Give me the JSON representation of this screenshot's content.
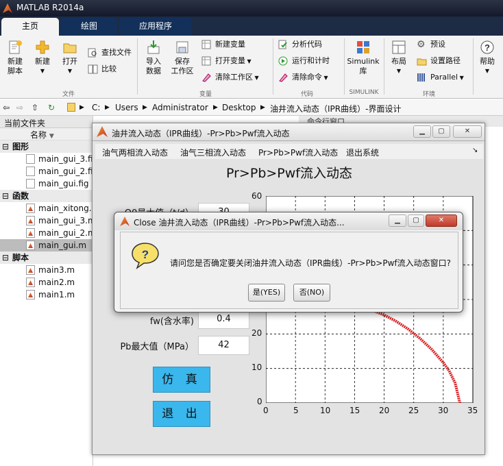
{
  "app_title": "MATLAB R2014a",
  "tabs": [
    "主页",
    "绘图",
    "应用程序"
  ],
  "ribbon": {
    "new_script": "新建\n脚本",
    "new": "新建",
    "open": "打开",
    "find_files": "查找文件",
    "compare": "比较",
    "import_data": "导入\n数据",
    "save_workspace": "保存\n工作区",
    "new_variable": "新建变量",
    "open_variable": "打开变量",
    "clear_workspace": "清除工作区",
    "analyze_code": "分析代码",
    "run_and_time": "运行和计时",
    "clear_commands": "清除命令",
    "simulink": "Simulink\n库",
    "layout": "布局",
    "preferences": "预设",
    "set_path": "设置路径",
    "parallel": "Parallel",
    "help": "帮助",
    "groups": {
      "file": "文件",
      "variable": "变量",
      "code": "代码",
      "simulink": "SIMULINK",
      "environment": "环境"
    }
  },
  "address": {
    "parts": [
      "C:",
      "Users",
      "Administrator",
      "Desktop",
      "油井流入动态（IPR曲线）-界面设计"
    ]
  },
  "current_folder": {
    "title": "当前文件夹",
    "name_column": "名称",
    "groups": [
      {
        "label": "图形",
        "files": [
          "main_gui_3.fig",
          "main_gui_2.fig",
          "main_gui.fig"
        ]
      },
      {
        "label": "函数",
        "files": [
          "main_xitong.m",
          "main_gui_3.m",
          "main_gui_2.m",
          "main_gui.m"
        ]
      },
      {
        "label": "脚本",
        "files": [
          "main3.m",
          "main2.m",
          "main1.m"
        ]
      }
    ]
  },
  "command_window_title": "命令行窗口",
  "gui": {
    "title": "油井流入动态（IPR曲线）-Pr>Pb>Pwf流入动态",
    "menu": [
      "油气两相流入动态",
      "油气三相流入动态",
      "Pr>Pb>Pwf流入动态",
      "退出系统"
    ],
    "plot_title": "Pr>Pb>Pwf流入动态",
    "fields": [
      {
        "label": "Q0最大值（t/d）",
        "value": "30"
      },
      {
        "label": "fw(含水率)",
        "value": "0.4"
      },
      {
        "label": "Pb最大值（MPa）",
        "value": "42"
      }
    ],
    "simulate_button": "仿 真",
    "exit_button": "退 出"
  },
  "chart_data": {
    "type": "line",
    "xlim": [
      0,
      35
    ],
    "ylim": [
      0,
      60
    ],
    "xticks": [
      0,
      5,
      10,
      15,
      20,
      25,
      30,
      35
    ],
    "yticks": [
      0,
      10,
      20,
      30,
      40,
      50,
      60
    ],
    "grid": true,
    "series": [
      {
        "color": "#d62020",
        "x": [
          17.8,
          20,
          22,
          24,
          26,
          28,
          30,
          31,
          32,
          32.8
        ],
        "y": [
          27,
          25.5,
          23.7,
          21.5,
          18.8,
          15.6,
          11.7,
          9.3,
          5.8,
          0
        ]
      }
    ]
  },
  "dialog": {
    "title": "Close 油井流入动态（IPR曲线）-Pr>Pb>Pwf流入动态...",
    "message": "请问您是否确定要关闭油井流入动态（IPR曲线）-Pr>Pb>Pwf流入动态窗口?",
    "yes": "是(YES)",
    "no": "否(NO)"
  }
}
